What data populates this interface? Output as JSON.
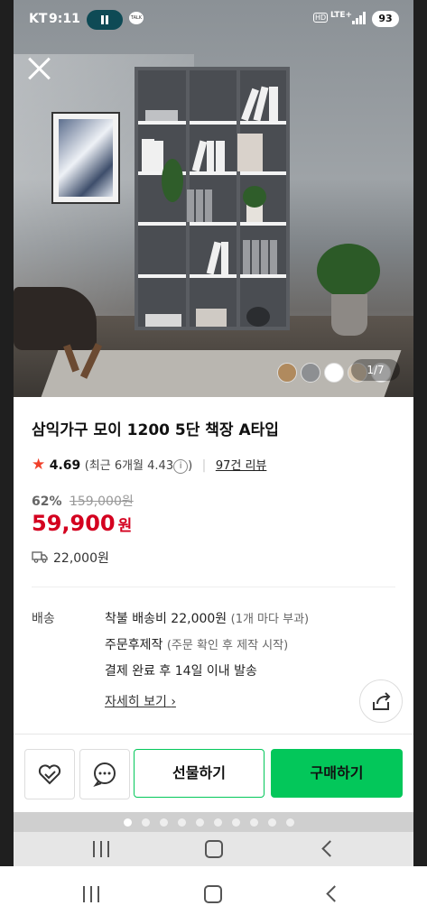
{
  "status_bar": {
    "carrier": "KT",
    "time": "9:11",
    "talk_icon_text": "TALK",
    "hd": "HD",
    "network": "LTE+",
    "battery": "93"
  },
  "gallery": {
    "counter": "1/7",
    "current_index": 1,
    "total": 7,
    "thumb_colors": [
      "#b08a5e",
      "#8d8f92",
      "#ffffff",
      "#d8c7b0",
      "#f4f4f4"
    ]
  },
  "product": {
    "title": "삼익가구 모이 1200 5단 책장 A타입",
    "rating": "4.69",
    "recent_rating": "(최근 6개월 4.43",
    "recent_close": ")",
    "info_glyph": "i",
    "review_link": "97건 리뷰",
    "discount_rate": "62%",
    "original_price": "159,000원",
    "price": "59,900",
    "price_unit": "원",
    "shipping_fee": "22,000원"
  },
  "delivery": {
    "label": "배송",
    "line1_main": "착불 배송비 22,000원",
    "line1_sub": "(1개 마다 부과)",
    "line2_main": "주문후제작",
    "line2_sub": "(주문 확인 후 제작 시작)",
    "line3": "결제 완료 후 14일 이내 발송",
    "detail_link": "자세히 보기",
    "detail_arrow": "›"
  },
  "bottom_bar": {
    "gift_label": "선물하기",
    "buy_label": "구매하기"
  },
  "page_dots": {
    "count": 10,
    "active": 0
  },
  "icons": [
    "close-icon",
    "heart-check-icon",
    "chat-icon",
    "share-icon",
    "truck-icon",
    "star-icon",
    "info-icon"
  ],
  "colors": {
    "accent_green": "#03c75a",
    "price_red": "#d4001f",
    "star": "#f0402a"
  }
}
